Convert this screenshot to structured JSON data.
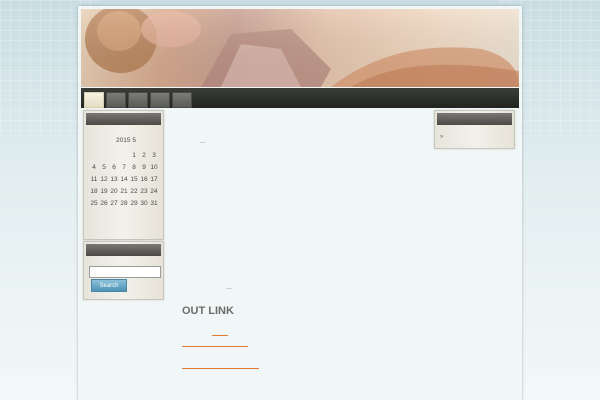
{
  "navigation": {
    "tabs": [
      "",
      "",
      "",
      "",
      ""
    ]
  },
  "calendar": {
    "month_label": "2015 5",
    "rows": [
      [
        "",
        "",
        "",
        "",
        "1",
        "2",
        "3"
      ],
      [
        "4",
        "5",
        "6",
        "7",
        "8",
        "9",
        "10"
      ],
      [
        "11",
        "12",
        "13",
        "14",
        "15",
        "16",
        "17"
      ],
      [
        "18",
        "19",
        "20",
        "21",
        "22",
        "23",
        "24"
      ],
      [
        "25",
        "26",
        "27",
        "28",
        "29",
        "30",
        "31"
      ]
    ]
  },
  "search": {
    "input_value": "",
    "button_label": "Search"
  },
  "content": {
    "ellipsis_top": "...",
    "ellipsis_bottom": "...",
    "section_title": "OUT LINK"
  },
  "right_widget": {
    "bullet": "»"
  },
  "colors": {
    "accent_line": "#e07b3a",
    "search_button": "#5a9cbc",
    "nav_bar": "#2b2d29"
  }
}
